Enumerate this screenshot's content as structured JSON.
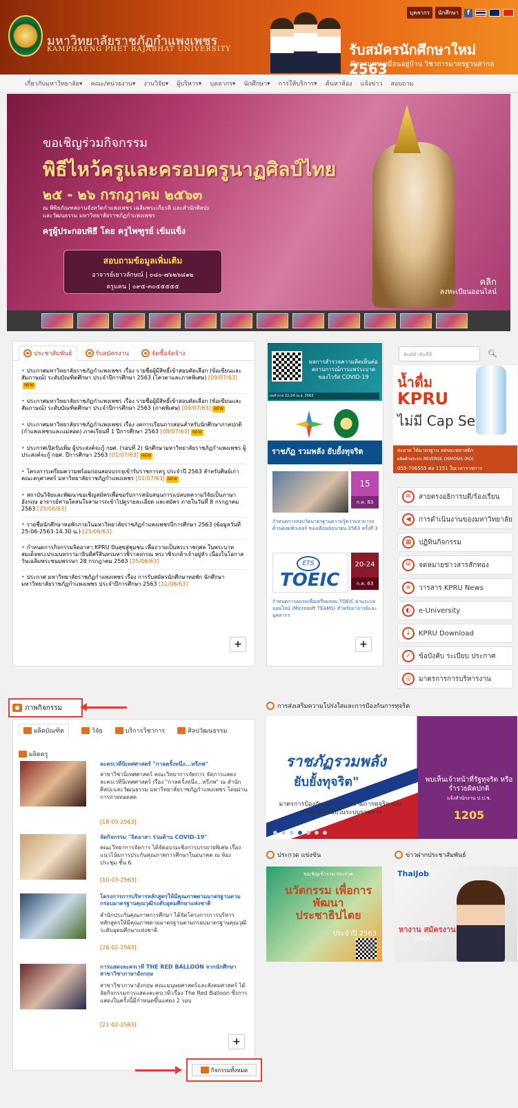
{
  "header": {
    "uni_th": "มหาวิทยาลัยราชภัฏกำแพงเพชร",
    "uni_en": "KAMPHAENG PHET RAJABHAT UNIVERSITY",
    "top_links": [
      "บุคลากร",
      "นักศึกษา"
    ],
    "recruit_title": "รับสมัครนักศึกษาใหม่ 2563",
    "recruit_sub": "มีความสุขเหมือนอยู่บ้าน วิชาการมาตรฐานสากล"
  },
  "nav": [
    "เกี่ยวกับมหาวิทยาลัย",
    "คณะ/หน่วยงาน",
    "งานวิจัย",
    "ผู้บริหาร",
    "บุคลากร",
    "นักศึกษา",
    "การให้บริการ",
    "ค้นหาห้อง",
    "แจ้งข่าว",
    "สอบถาม"
  ],
  "banner": {
    "invite": "ขอเชิญร่วมกิจกรรม",
    "title": "พิธีไหว้ครูและครอบครูนาฏศิลป์ไทย",
    "date": "๒๕ - ๒๖ กรกฎาคม ๒๕๖๓",
    "venue": "ณ พิพิธภัณฑสถานจังหวัดกำแพงเพชร เฉลิมพระเกียรติ และสำนักศิลปะและวัฒนธรรม มหาวิทยาลัยราชภัฏกำแพงเพชร",
    "host": "ครูผู้ประกอบพิธี โดย ครูไพฑูรย์ เข้มแข็ง",
    "box_title": "สอบถามข้อมูลเพิ่มเติม",
    "box_l1": "อาจารย์เยาวลักษณ์ | ๐๘๐-๗๖๒๖๘๑๒",
    "box_l2": "ครูแคน | ๐๙๕-๓๐๕๕๕๕๕",
    "click": "คลิก",
    "click_sub": "ลงทะเบียนออนไลน์"
  },
  "pr": {
    "tabs": [
      "ประชาสัมพันธ์",
      "รับสมัครงาน",
      "จัดซื้อจัดจ้าง"
    ],
    "news": [
      {
        "text": "ประกาศมหาวิทยาลัยราชภัฏกำแพงเพชร เรื่อง รายชื่อผู้มีสิทธิ์เข้าสอบคัดเลือก (ข้อเขียนและสัมภาษณ์) ระดับบัณฑิตศึกษา ประจำปีการศึกษา 2563 (โควตาและภาคพิเศษ)",
        "date": "[09/07/63]"
      },
      {
        "text": "ประกาศมหาวิทยาลัยราชภัฏกำแพงเพชร เรื่อง รายชื่อผู้มีสิทธิ์เข้าสอบคัดเลือก (ข้อเขียนและสัมภาษณ์) ระดับบัณฑิตศึกษา ประจำปีการศึกษา 2563 (ภาคพิเศษ)",
        "date": "[09/07/63]"
      },
      {
        "text": "ประกาศมหาวิทยาลัยราชภัฏกำแพงเพชร เรื่อง งดการเรียนการสอนสำหรับนักศึกษาภาคปกติ (กำแพงเพชรและแม่สอด) ภาคเรียนที่ 1 ปีการศึกษา 2563",
        "date": "[08/07/63]"
      },
      {
        "text": "ประกาศเปิดรับเพิ่ม ผู้ประสงค์จะกู้ กยศ. (รอบที่ 2) นักศึกษามหาวิทยาลัยราชภัฏกำแพงเพชร ผู้ประสงค์จะกู้ กยศ. ปีการศึกษา 2563",
        "date": "[01/07/63]"
      },
      {
        "text": "โครงการเตรียมความพร้อมก่อนสอบบรรจุเข้ารับราชการครู ประจำปี 2563 สำหรับศิษย์เก่าคณะครุศาสตร์ มหาวิทยาลัยราชภัฏกำแพงเพชร",
        "date": "[01/07/63]"
      },
      {
        "text": "สถาบันวิจัยและพัฒนาขอเชิญสมัครเพื่อขอรับการสนับสนุนการแปลบทความวิจัยเป็นภาษาอังกฤษ อาจารย์ท่านใดสนใจสามารถเข้าไปดูรายละเอียด และสมัคร ภายในวันที่ 8 กรกฎาคม 2563",
        "date": "[25/06/63]"
      },
      {
        "text": "รายชื่อนักศึกษาหอพักภายในมหาวิทยาลัยราชภัฏกำแพงเพชรปีการศึกษา 2563 (ข้อมูลวันที่ 25-06-2563-14.30 น.)",
        "date": "[25/06/63]"
      },
      {
        "text": "กำหนดการกิจกรรมจิตอาสา KPRU ปันสุขสู่ชุมชน เพื่อถวายเป็นพระราชกุศล ในพระบาทสมเด็จพระปรเมนทรรามาธิบดีศรีสินทรมหาวชิราลงกรณ พระวชิรเกล้าเจ้าอยู่หัว เนื่องในโอกาสวันเฉลิมพระชนมพรรษา 28 กรกฎาคม 2563",
        "date": "[25/06/63]"
      },
      {
        "text": "ประกาศ มหาวิทยาลัยราชภัฏกำแพงเพชร เรื่อง การรับสมัครนักศึกษาหอพัก นักศึกษา มหาวิทยาลัยราชภัฏกำแพงเพชร ประจำปีการศึกษา 2563",
        "date": "[11/06/63]"
      }
    ]
  },
  "mid": {
    "poll_text": "ผลการสำรวจความคิดเห็นต่อสถานการณ์การแพร่ระบาดของไวรัส COVID-19",
    "poll_date": "ผลสำรวจ 22-24 เม.ย. 2563",
    "anti": "ราชภัฏ รวมพลัง ยับยั้งทุจริต",
    "ev1_num": "15",
    "ev1_mon": "ก.ค. 63",
    "ev1_desc": "กำหนดการสอบวัดมาตรฐานความรู้ความสามารถด้านคอมพิวเตอร์ ของเดือนมิถุนายน 2563 ครั้งที่ 3",
    "ets": "ETS",
    "toeic": "TOEIC",
    "ev2_num": "20-24",
    "ev2_mon": "ก.ค. 63",
    "ev2_desc": "กำหนดการอบรมเพื่อเตรียมสอบ TOEIC ผ่านระบบออนไลน์ (Microsoft TEAMS) สำหรับอาจารย์และบุคลากร"
  },
  "right": {
    "search_placeholder": "พิมพ์คำค้นที่นี่",
    "water_t1": "น้ำดื่ม",
    "water_t2": "KPRU",
    "water_t3": "ไม่มี Cap Seal",
    "water_l1": "สะอาด ได้มาตรฐาน ลดขยะพลาสติก",
    "water_l2": "ผลิตด้วยระบบ REVERSE OSMOSIS (RO)",
    "water_l3": "055-706555 ต่อ 1151 ในเวลาราชการ",
    "links": [
      "สายตรงอธิการบดี/ร้องเรียน",
      "การดำเนินงานของมหาวิทยาลัย",
      "ปฏิทินกิจกรรม",
      "จดหมายข่าวสารสักทอง",
      "วารสาร KPRU News",
      "e-University",
      "KPRU Download",
      "ข้อบังคับ ระเบียบ ประกาศ",
      "มาตรการการบริหารงาน"
    ]
  },
  "activity": {
    "heading": "ภาพกิจกรรม",
    "tabs": [
      "ผลิตบัณฑิต",
      "วิจัย",
      "บริการวิชาการ",
      "ศิลปวัฒนธรรม",
      "ผลิตครู"
    ],
    "items": [
      {
        "title": "ละครเวทีนิเทศศาสตร์ \"กาลครั้งหนึ่ง...ทรีภพ\"",
        "desc": "สาขาวิชานิเทศศาสตร์ คณะวิทยาการจัดการ จัดการแสดงละครเวทีนิเทศศาสตร์ เรื่อง \"กาลครั้งหนึ่ง...ทรีภพ\" ณ สำนักศิลปะและวัฒนธรรม มหาวิทยาลัยราชภัฏกำแพงเพชร โดยผ่านการถ่ายทอดสด",
        "date": "[18-03-2563]"
      },
      {
        "title": "จัดกิจกรรม \"จิตอาสา ร่วมต้าน COVID-19\"",
        "desc": "คณะวิทยาการจัดการ ได้จัดอบรมเชิงการบรรยายพิเศษ เรื่อง แนวโน้มการประกันคุณภาพการศึกษาในอนาคต ณ ห้องประชุม ชั้น 6",
        "date": "[10-03-2563]"
      },
      {
        "title": "โครงการการบริหารหลักสูตรให้มีคุณภาพตามมาตรฐานตามกรอบมาตรฐานคุณวุฒิระดับอุดมศึกษาแห่งชาติ",
        "desc": "สำนักประกันคุณภาพการศึกษา ได้จัดโครงการการบริหารหลักสูตรให้มีคุณภาพตามมาตรฐานตามกรอบมาตรฐานคุณวุฒิระดับอุดมศึกษาแห่งชาติ",
        "date": "[26-02-2563]"
      },
      {
        "title": "การแสดงละครเวที THE RED BALLOON จากนักศึกษาสาขาวิชาภาษาอังกฤษ",
        "desc": "สาขาวิชาภาษาอังกฤษ คณะมนุษยศาสตร์และสังคมศาสตร์ ได้จัดกิจกรรมการแสดงละครเวที เรื่อง The Red Balloon ซึ่งการแสดงในครั้งนี้มีกำหนดขึ้นแสดง 2 รอบ",
        "date": "[21-02-2563]"
      }
    ],
    "all_label": "กิจกรรมทั้งหมด"
  },
  "transparency": {
    "heading": "การส่งเสริมความโปร่งใสและการป้องกันการทุจริต",
    "t1": "ราชภัฏรวมพลัง",
    "t2": "ยับยั้งทุจริต\"",
    "t3": "มาตรการป้องกันและปราบปรามการทุจริต และประพฤติมิชอบในระบบราชการ",
    "r1": "พบเห็นเจ้าหน้าที่รัฐทุจริต หรือร่ำรวยผิดปกติ",
    "r2": "แจ้งสำนักงาน ป.ป.ช.",
    "r3": "1205"
  },
  "contest": {
    "heading": "ประกวด แข่งขัน",
    "t1": "ขอเชิญเข้าร่วม ประกวด",
    "t2": "นวัตกรรม เพื่อการพัฒนา ประชาธิปไตย",
    "t3": "ประจำปี 2563"
  },
  "job": {
    "heading": "ข่าวฝากประชาสัมพันธ์",
    "logo": "ThaiJob",
    "t1": "หางาน สมัครงาน",
    "t2": "Click!"
  }
}
